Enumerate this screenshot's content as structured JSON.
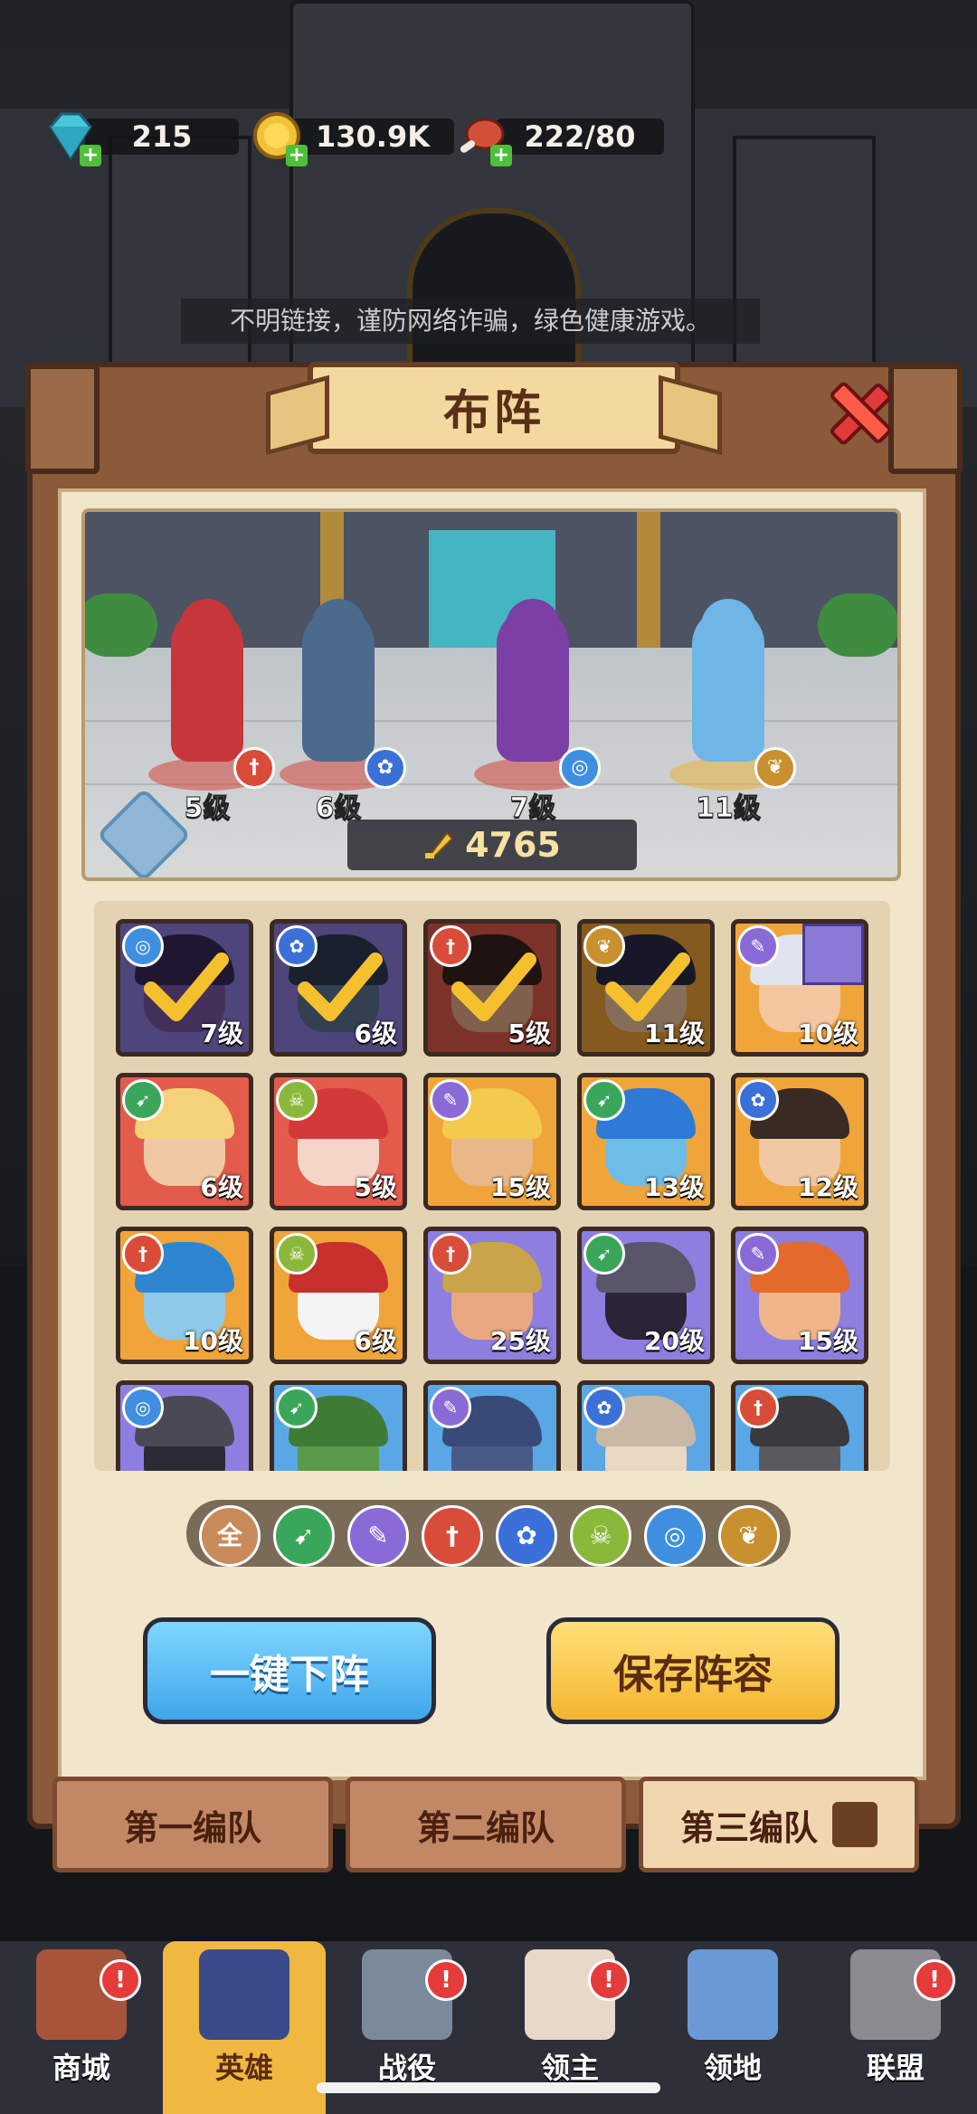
{
  "resources": [
    {
      "id": "gems",
      "value": "215",
      "color": "#49c7d6"
    },
    {
      "id": "gold",
      "value": "130.9K",
      "color": "#f2c23a"
    },
    {
      "id": "stamina",
      "value": "222/80",
      "color": "#d2503a"
    }
  ],
  "notice": "不明链接，谨防网络诈骗，绿色健康游戏。",
  "panel": {
    "title": "布阵"
  },
  "lineup": [
    {
      "level": "5级",
      "class": "warrior",
      "class_color": "#d94c3a",
      "body_color": "#c7363a"
    },
    {
      "level": "6级",
      "class": "beast",
      "class_color": "#3b70d9",
      "body_color": "#4b6a8c"
    },
    {
      "level": "7级",
      "class": "spiral",
      "class_color": "#3f8fe0",
      "body_color": "#7c3fa6"
    },
    {
      "level": "11级",
      "class": "wing",
      "class_color": "#c8902e",
      "body_color": "#6fb6e6"
    }
  ],
  "power": "4765",
  "heroes": [
    {
      "level": "7级",
      "class": "spiral",
      "bg": "purple",
      "selected": true,
      "face": "#7a5aa6",
      "hair": "#3a2a5a"
    },
    {
      "level": "6级",
      "class": "beast",
      "bg": "purple",
      "selected": true,
      "face": "#5c7694",
      "hair": "#2e3c55"
    },
    {
      "level": "5级",
      "class": "warrior",
      "bg": "red",
      "selected": true,
      "face": "#e6b08a",
      "hair": "#3a2420"
    },
    {
      "level": "11级",
      "class": "wing",
      "bg": "orange",
      "selected": true,
      "face": "#f1c8a4",
      "hair": "#2a2a4a"
    },
    {
      "level": "10级",
      "class": "mage",
      "bg": "orange",
      "selected": false,
      "face": "#f4c7a0",
      "hair": "#dfe4ef",
      "weapon": true
    },
    {
      "level": "6级",
      "class": "ranger",
      "bg": "red",
      "selected": false,
      "face": "#f1c8a4",
      "hair": "#f3d27a"
    },
    {
      "level": "5级",
      "class": "skull",
      "bg": "red",
      "selected": false,
      "face": "#f3d6c8",
      "hair": "#d23a3a"
    },
    {
      "level": "15级",
      "class": "mage",
      "bg": "orange",
      "selected": false,
      "face": "#e9b888",
      "hair": "#f3c94e"
    },
    {
      "level": "13级",
      "class": "ranger",
      "bg": "orange",
      "selected": false,
      "face": "#6dbde6",
      "hair": "#2f7ad6"
    },
    {
      "level": "12级",
      "class": "beast",
      "bg": "orange",
      "selected": false,
      "face": "#f1c8a4",
      "hair": "#3a2a24"
    },
    {
      "level": "10级",
      "class": "warrior",
      "bg": "orange",
      "selected": false,
      "face": "#8fc9ea",
      "hair": "#2e86d0"
    },
    {
      "level": "6级",
      "class": "skull",
      "bg": "orange",
      "selected": false,
      "face": "#f4f4f4",
      "hair": "#c8302e"
    },
    {
      "level": "25级",
      "class": "warrior",
      "bg": "purple",
      "selected": false,
      "face": "#e9a882",
      "hair": "#c9a44a"
    },
    {
      "level": "20级",
      "class": "ranger",
      "bg": "purple",
      "selected": false,
      "face": "#2a2436",
      "hair": "#5a566a"
    },
    {
      "level": "15级",
      "class": "mage",
      "bg": "purple",
      "selected": false,
      "face": "#f0b68a",
      "hair": "#e36a2a"
    },
    {
      "level": "",
      "class": "spiral",
      "bg": "purple",
      "selected": false,
      "face": "#2b2b33",
      "hair": "#4a4a56"
    },
    {
      "level": "",
      "class": "ranger",
      "bg": "blue",
      "selected": false,
      "face": "#5a9a4a",
      "hair": "#3e7c36"
    },
    {
      "level": "",
      "class": "mage",
      "bg": "blue",
      "selected": false,
      "face": "#4a5a88",
      "hair": "#3a4a78"
    },
    {
      "level": "",
      "class": "beast",
      "bg": "blue",
      "selected": false,
      "face": "#e8d8c4",
      "hair": "#c8b8a4"
    },
    {
      "level": "",
      "class": "warrior",
      "bg": "blue",
      "selected": false,
      "face": "#5a5a5e",
      "hair": "#3a3a3e"
    }
  ],
  "class_colors": {
    "spiral": "#3f8fe0",
    "beast": "#3b70d9",
    "warrior": "#d94c3a",
    "wing": "#c8902e",
    "mage": "#8a6ad6",
    "ranger": "#3aa65a",
    "skull": "#8ab83a"
  },
  "class_glyphs": {
    "spiral": "◎",
    "beast": "✿",
    "warrior": "†",
    "wing": "❦",
    "mage": "✎",
    "ranger": "➹",
    "skull": "☠"
  },
  "filters": [
    {
      "id": "all",
      "label": "全",
      "color": "#c98a5a"
    },
    {
      "id": "ranger",
      "label": "",
      "color": "#3aa65a"
    },
    {
      "id": "mage",
      "label": "",
      "color": "#8a6ad6"
    },
    {
      "id": "warrior",
      "label": "",
      "color": "#d94c3a"
    },
    {
      "id": "beast",
      "label": "",
      "color": "#3b70d9"
    },
    {
      "id": "skull",
      "label": "",
      "color": "#8ab83a"
    },
    {
      "id": "spiral",
      "label": "",
      "color": "#3f8fe0"
    },
    {
      "id": "wing",
      "label": "",
      "color": "#c8902e"
    }
  ],
  "buttons": {
    "unequip_all": "一键下阵",
    "save": "保存阵容"
  },
  "tabs": [
    {
      "label": "第一编队",
      "active": false
    },
    {
      "label": "第二编队",
      "active": false
    },
    {
      "label": "第三编队",
      "active": true
    }
  ],
  "nav": [
    {
      "label": "商城",
      "icon": "shop-icon",
      "alert": true,
      "active": false
    },
    {
      "label": "英雄",
      "icon": "hero-cards-icon",
      "alert": false,
      "active": true
    },
    {
      "label": "战役",
      "icon": "battle-sword-icon",
      "alert": true,
      "active": false
    },
    {
      "label": "领主",
      "icon": "lord-crown-icon",
      "alert": true,
      "active": false
    },
    {
      "label": "领地",
      "icon": "territory-castle-icon",
      "alert": false,
      "active": false
    },
    {
      "label": "联盟",
      "icon": "alliance-helmet-icon",
      "alert": true,
      "active": false
    }
  ]
}
